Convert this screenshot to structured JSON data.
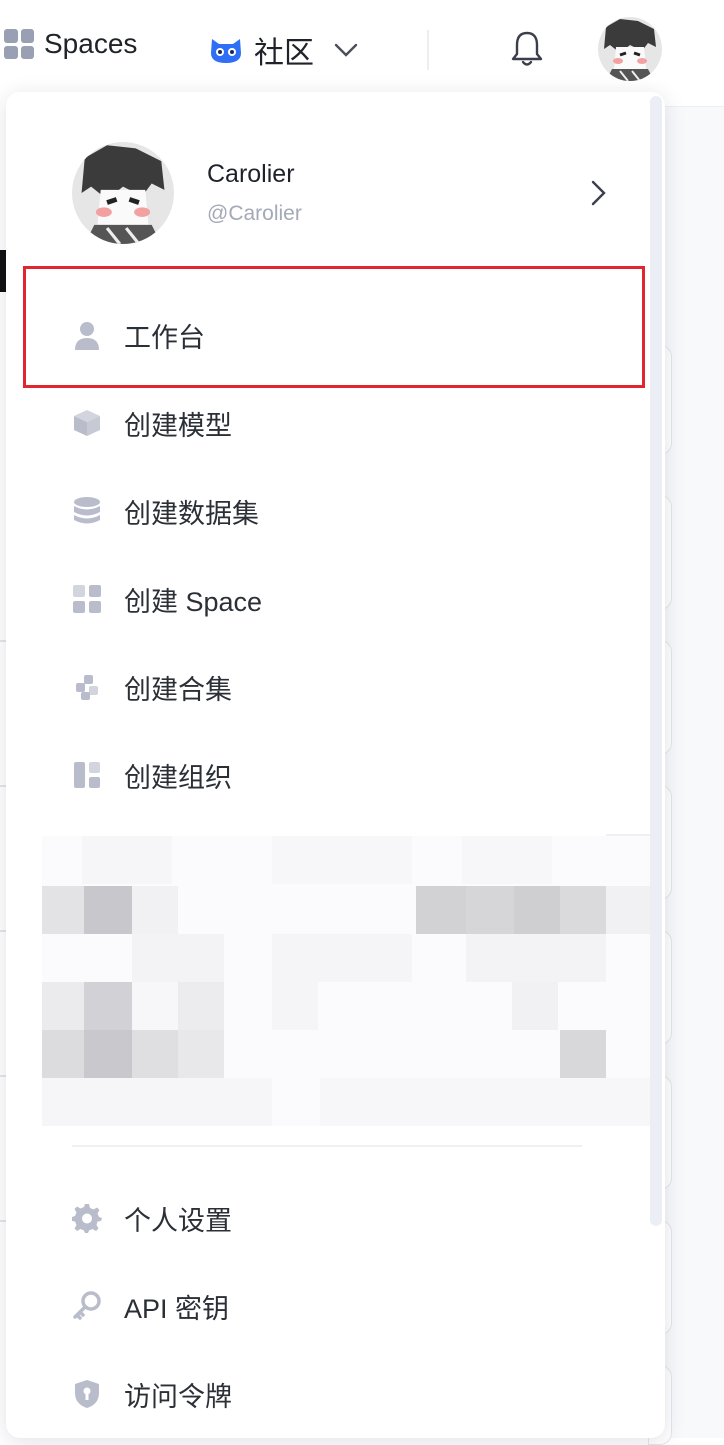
{
  "topbar": {
    "spaces_label": "Spaces",
    "community_label": "社区",
    "icons": [
      "spaces-grid-icon",
      "community-logo-icon",
      "chevron-down-icon",
      "bell-icon",
      "avatar"
    ]
  },
  "menu": {
    "profile": {
      "name": "Carolier",
      "handle": "@Carolier"
    },
    "items": [
      {
        "label": "工作台",
        "icon": "user-icon",
        "highlighted": true
      },
      {
        "label": "创建模型",
        "icon": "cube-icon"
      },
      {
        "label": "创建数据集",
        "icon": "database-icon"
      },
      {
        "label": "创建 Space",
        "icon": "grid-icon"
      },
      {
        "label": "创建合集",
        "icon": "collection-icon"
      },
      {
        "label": "创建组织",
        "icon": "organization-icon"
      }
    ],
    "settings_items": [
      {
        "label": "个人设置",
        "icon": "gear-icon"
      },
      {
        "label": "API 密钥",
        "icon": "key-icon"
      },
      {
        "label": "访问令牌",
        "icon": "shield-icon"
      }
    ]
  },
  "colors": {
    "highlight_border": "#e0262e",
    "icon_gray": "#b9bccb",
    "community_logo_blue": "#2f6ff5"
  }
}
